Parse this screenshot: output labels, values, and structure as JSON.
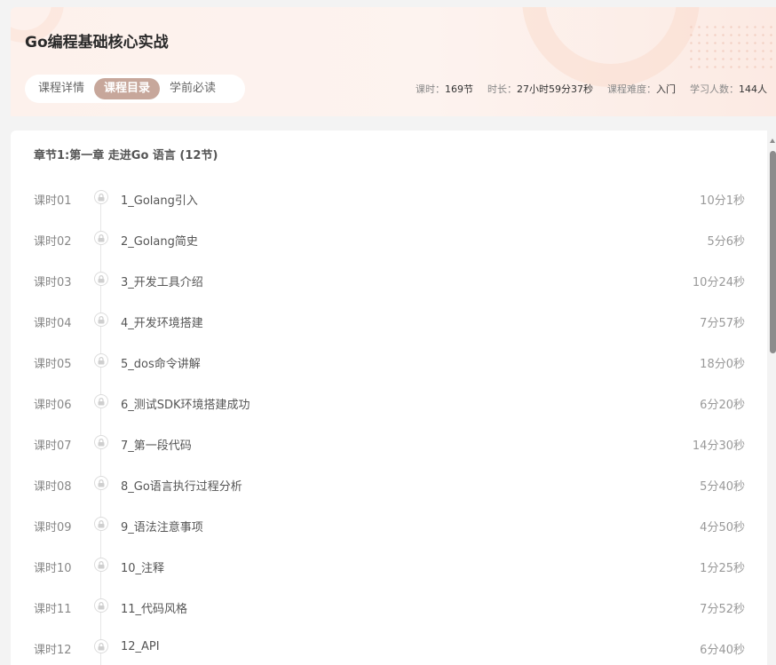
{
  "header": {
    "title": "Go编程基础核心实战",
    "tabs": [
      {
        "label": "课程详情",
        "active": false
      },
      {
        "label": "课程目录",
        "active": true
      },
      {
        "label": "学前必读",
        "active": false
      }
    ],
    "meta": [
      {
        "label": "课时：",
        "value": "169节"
      },
      {
        "label": "时长：",
        "value": "27小时59分37秒"
      },
      {
        "label": "课程难度：",
        "value": "入门"
      },
      {
        "label": "学习人数：",
        "value": "144人"
      }
    ]
  },
  "chapter": {
    "title": "章节1:第一章 走进Go 语言 (12节)",
    "lessons": [
      {
        "index": "课时01",
        "name": "1_Golang引入",
        "duration": "10分1秒"
      },
      {
        "index": "课时02",
        "name": "2_Golang简史",
        "duration": "5分6秒"
      },
      {
        "index": "课时03",
        "name": "3_开发工具介绍",
        "duration": "10分24秒"
      },
      {
        "index": "课时04",
        "name": "4_开发环境搭建",
        "duration": "7分57秒"
      },
      {
        "index": "课时05",
        "name": "5_dos命令讲解",
        "duration": "18分0秒"
      },
      {
        "index": "课时06",
        "name": "6_测试SDK环境搭建成功",
        "duration": "6分20秒"
      },
      {
        "index": "课时07",
        "name": "7_第一段代码",
        "duration": "14分30秒"
      },
      {
        "index": "课时08",
        "name": "8_Go语言执行过程分析",
        "duration": "5分40秒"
      },
      {
        "index": "课时09",
        "name": "9_语法注意事项",
        "duration": "4分50秒"
      },
      {
        "index": "课时10",
        "name": "10_注释",
        "duration": "1分25秒"
      },
      {
        "index": "课时11",
        "name": "11_代码风格",
        "duration": "7分52秒"
      },
      {
        "index": "课时12",
        "name": "12_API",
        "duration": "6分40秒"
      }
    ]
  },
  "colors": {
    "accent": "#c7a79b",
    "header_bg": "#fdf1ec"
  },
  "icons": {
    "lesson_status": "lock-icon"
  }
}
